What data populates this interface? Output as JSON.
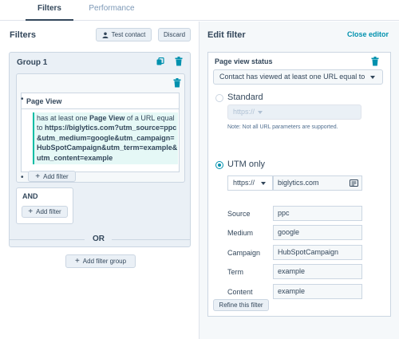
{
  "tabs": [
    {
      "label": "Filters"
    },
    {
      "label": "Performance"
    }
  ],
  "left": {
    "title": "Filters",
    "test_contact_label": "Test contact",
    "discard_label": "Discard",
    "group": {
      "title": "Group 1",
      "filter": {
        "label": "Page View",
        "desc_prefix": "has at least one ",
        "desc_bold1": "Page View",
        "desc_mid": " of a URL equal to ",
        "desc_url": "https://biglytics.com?utm_source=ppc&utm_medium=google&utm_campaign=HubSpotCampaign&utm_term=example&utm_content=example"
      },
      "add_filter_label": "Add filter"
    },
    "and_title": "AND",
    "and_add_filter_label": "Add filter",
    "or_label": "OR",
    "add_filter_group_label": "Add filter group"
  },
  "right": {
    "title": "Edit filter",
    "close_label": "Close editor",
    "status_title": "Page view status",
    "status_value": "Contact has viewed at least one URL equal to",
    "standard_label": "Standard",
    "standard_placeholder": "https://",
    "note": "Note: Not all URL parameters are supported.",
    "utm_label": "UTM only",
    "protocol": "https://",
    "domain": "biglytics.com",
    "fields": [
      {
        "label": "Source",
        "value": "ppc"
      },
      {
        "label": "Medium",
        "value": "google"
      },
      {
        "label": "Campaign",
        "value": "HubSpotCampaign"
      },
      {
        "label": "Term",
        "value": "example"
      },
      {
        "label": "Content",
        "value": "example"
      }
    ],
    "refine_label": "Refine this filter"
  },
  "colors": {
    "accent": "#0091ae",
    "teal": "#00bda5",
    "text": "#33475b",
    "border": "#cbd6e2"
  },
  "icons": [
    "person-icon",
    "copy-icon",
    "trash-icon",
    "plus-icon",
    "chevron-down-icon",
    "url-params-icon"
  ]
}
